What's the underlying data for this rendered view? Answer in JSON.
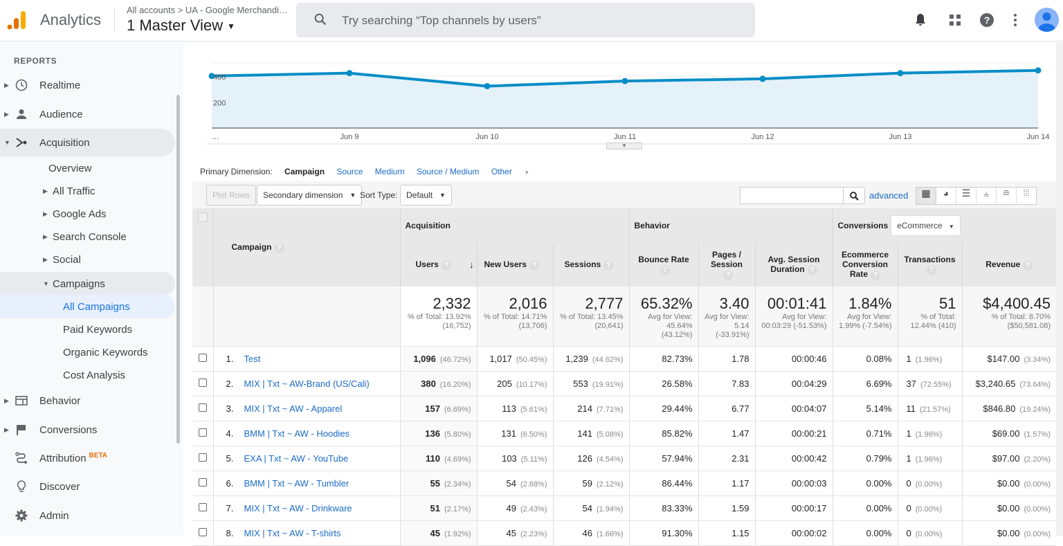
{
  "header": {
    "app_name": "Analytics",
    "breadcrumb": "All accounts > UA - Google Merchandi…",
    "view_name": "1 Master View",
    "search_placeholder": "Try searching “Top channels by users”"
  },
  "sidebar": {
    "section": "REPORTS",
    "items": [
      {
        "label": "Realtime",
        "icon": "clock-icon"
      },
      {
        "label": "Audience",
        "icon": "person-icon"
      },
      {
        "label": "Acquisition",
        "icon": "acquisition-icon"
      },
      {
        "label": "Overview"
      },
      {
        "label": "All Traffic"
      },
      {
        "label": "Google Ads"
      },
      {
        "label": "Search Console"
      },
      {
        "label": "Social"
      },
      {
        "label": "Campaigns"
      },
      {
        "label": "All Campaigns"
      },
      {
        "label": "Paid Keywords"
      },
      {
        "label": "Organic Keywords"
      },
      {
        "label": "Cost Analysis"
      },
      {
        "label": "Behavior",
        "icon": "behavior-icon"
      },
      {
        "label": "Conversions",
        "icon": "flag-icon"
      },
      {
        "label": "Attribution",
        "icon": "attribution-icon",
        "badge": "BETA"
      },
      {
        "label": "Discover",
        "icon": "lightbulb-icon"
      },
      {
        "label": "Admin",
        "icon": "gear-icon"
      }
    ]
  },
  "chart_data": {
    "type": "line",
    "x": [
      "…",
      "Jun 9",
      "Jun 10",
      "Jun 11",
      "Jun 12",
      "Jun 13",
      "Jun 14"
    ],
    "values": [
      400,
      422,
      322,
      361,
      378,
      422,
      443
    ],
    "ytick_labels": [
      "400",
      "200"
    ],
    "ylim": [
      0,
      500
    ],
    "grid": true,
    "color": "#058dc7"
  },
  "dimension": {
    "label": "Primary Dimension:",
    "current": "Campaign",
    "options": [
      "Source",
      "Medium",
      "Source / Medium",
      "Other"
    ]
  },
  "toolbar": {
    "plot_rows": "Plot Rows",
    "secondary": "Secondary dimension",
    "sort_label": "Sort Type:",
    "sort_value": "Default",
    "advanced": "advanced",
    "search_value": ""
  },
  "table": {
    "groups": {
      "acquisition": "Acquisition",
      "behavior": "Behavior",
      "conversions": "Conversions",
      "conv_select": "eCommerce"
    },
    "headers": {
      "campaign": "Campaign",
      "users": "Users",
      "new_users": "New Users",
      "sessions": "Sessions",
      "bounce": "Bounce Rate",
      "pages": "Pages / Session",
      "duration": "Avg. Session Duration",
      "ecr": "Ecommerce Conversion Rate",
      "transactions": "Transactions",
      "revenue": "Revenue"
    },
    "totals": {
      "users": "2,332",
      "users_sub": "% of Total: 13.92% (16,752)",
      "new_users": "2,016",
      "new_users_sub": "% of Total: 14.71% (13,706)",
      "sessions": "2,777",
      "sessions_sub": "% of Total: 13.45% (20,641)",
      "bounce": "65.32%",
      "bounce_sub": "Avg for View: 45.64% (43.12%)",
      "pages": "3.40",
      "pages_sub": "Avg for View: 5.14 (-33.91%)",
      "duration": "00:01:41",
      "duration_sub": "Avg for View: 00:03:29 (-51.53%)",
      "ecr": "1.84%",
      "ecr_sub": "Avg for View: 1.99% (-7.54%)",
      "transactions": "51",
      "transactions_sub": "% of Total: 12.44% (410)",
      "revenue": "$4,400.45",
      "revenue_sub": "% of Total: 8.70% ($50,581.08)"
    },
    "rows": [
      {
        "n": "1.",
        "campaign": "Test",
        "users": "1,096",
        "users_p": "(46.72%)",
        "new": "1,017",
        "new_p": "(50.45%)",
        "sess": "1,239",
        "sess_p": "(44.62%)",
        "bounce": "82.73%",
        "pages": "1.78",
        "dur": "00:00:46",
        "ecr": "0.08%",
        "tx": "1",
        "tx_p": "(1.96%)",
        "rev": "$147.00",
        "rev_p": "(3.34%)"
      },
      {
        "n": "2.",
        "campaign": "MIX | Txt ~ AW-Brand (US/Cali)",
        "users": "380",
        "users_p": "(16.20%)",
        "new": "205",
        "new_p": "(10.17%)",
        "sess": "553",
        "sess_p": "(19.91%)",
        "bounce": "26.58%",
        "pages": "7.83",
        "dur": "00:04:29",
        "ecr": "6.69%",
        "tx": "37",
        "tx_p": "(72.55%)",
        "rev": "$3,240.65",
        "rev_p": "(73.64%)"
      },
      {
        "n": "3.",
        "campaign": "MIX | Txt ~ AW - Apparel",
        "users": "157",
        "users_p": "(6.69%)",
        "new": "113",
        "new_p": "(5.61%)",
        "sess": "214",
        "sess_p": "(7.71%)",
        "bounce": "29.44%",
        "pages": "6.77",
        "dur": "00:04:07",
        "ecr": "5.14%",
        "tx": "11",
        "tx_p": "(21.57%)",
        "rev": "$846.80",
        "rev_p": "(19.24%)"
      },
      {
        "n": "4.",
        "campaign": "BMM | Txt ~ AW - Hoodies",
        "users": "136",
        "users_p": "(5.80%)",
        "new": "131",
        "new_p": "(6.50%)",
        "sess": "141",
        "sess_p": "(5.08%)",
        "bounce": "85.82%",
        "pages": "1.47",
        "dur": "00:00:21",
        "ecr": "0.71%",
        "tx": "1",
        "tx_p": "(1.96%)",
        "rev": "$69.00",
        "rev_p": "(1.57%)"
      },
      {
        "n": "5.",
        "campaign": "EXA | Txt ~ AW - YouTube",
        "users": "110",
        "users_p": "(4.69%)",
        "new": "103",
        "new_p": "(5.11%)",
        "sess": "126",
        "sess_p": "(4.54%)",
        "bounce": "57.94%",
        "pages": "2.31",
        "dur": "00:00:42",
        "ecr": "0.79%",
        "tx": "1",
        "tx_p": "(1.96%)",
        "rev": "$97.00",
        "rev_p": "(2.20%)"
      },
      {
        "n": "6.",
        "campaign": "BMM | Txt ~ AW - Tumbler",
        "users": "55",
        "users_p": "(2.34%)",
        "new": "54",
        "new_p": "(2.68%)",
        "sess": "59",
        "sess_p": "(2.12%)",
        "bounce": "86.44%",
        "pages": "1.17",
        "dur": "00:00:03",
        "ecr": "0.00%",
        "tx": "0",
        "tx_p": "(0.00%)",
        "rev": "$0.00",
        "rev_p": "(0.00%)"
      },
      {
        "n": "7.",
        "campaign": "MIX | Txt ~ AW - Drinkware",
        "users": "51",
        "users_p": "(2.17%)",
        "new": "49",
        "new_p": "(2.43%)",
        "sess": "54",
        "sess_p": "(1.94%)",
        "bounce": "83.33%",
        "pages": "1.59",
        "dur": "00:00:17",
        "ecr": "0.00%",
        "tx": "0",
        "tx_p": "(0.00%)",
        "rev": "$0.00",
        "rev_p": "(0.00%)"
      },
      {
        "n": "8.",
        "campaign": "MIX | Txt ~ AW - T-shirts",
        "users": "45",
        "users_p": "(1.92%)",
        "new": "45",
        "new_p": "(2.23%)",
        "sess": "46",
        "sess_p": "(1.66%)",
        "bounce": "91.30%",
        "pages": "1.15",
        "dur": "00:00:02",
        "ecr": "0.00%",
        "tx": "0",
        "tx_p": "(0.00%)",
        "rev": "$0.00",
        "rev_p": "(0.00%)"
      }
    ]
  }
}
